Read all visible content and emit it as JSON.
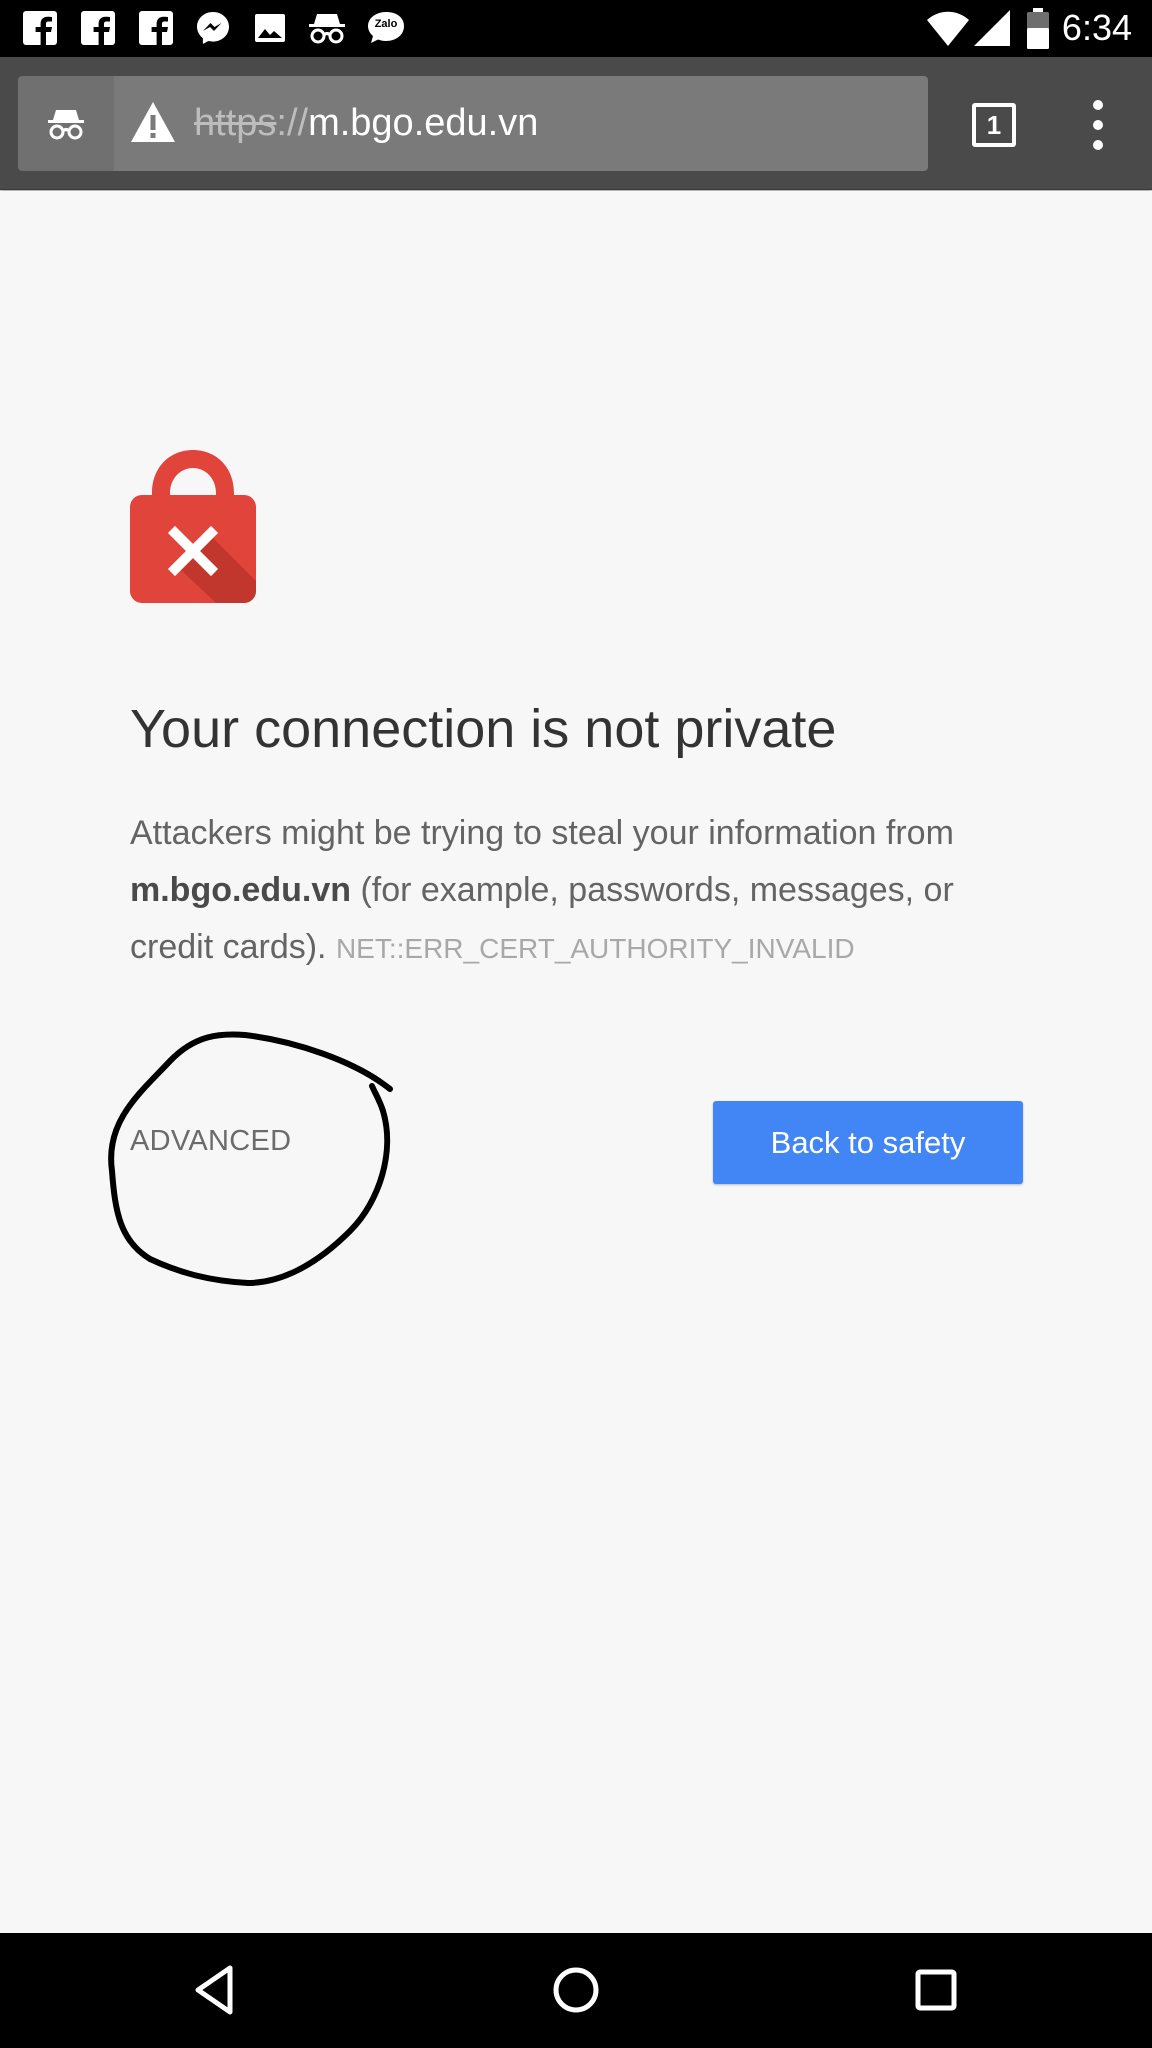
{
  "status_bar": {
    "time": "6:34",
    "notification_icons": [
      "facebook-icon",
      "facebook-icon",
      "facebook-icon",
      "messenger-icon",
      "gallery-icon",
      "incognito-icon",
      "zalo-icon"
    ],
    "zalo_label": "Zalo",
    "system_icons": [
      "wifi-icon",
      "signal-icon",
      "battery-icon"
    ]
  },
  "toolbar": {
    "url_scheme": "https",
    "url_separator": "://",
    "url_host": "m.bgo.edu.vn",
    "tab_count": "1"
  },
  "interstitial": {
    "heading": "Your connection is not private",
    "body_prefix": "Attackers might be trying to steal your information from",
    "body_domain": "m.bgo.edu.vn",
    "body_suffix": "(for example, passwords, messages, or credit cards).",
    "error_code": "NET::ERR_CERT_AUTHORITY_INVALID",
    "advanced_label": "ADVANCED",
    "back_button_label": "Back to safety"
  },
  "colors": {
    "status_bar_bg": "#000000",
    "toolbar_bg": "#4a4a4a",
    "omnibox_bg": "#7a7a7a",
    "page_bg": "#f7f7f7",
    "lock_red": "#e0443a",
    "button_blue": "#4285f4",
    "heading_text": "#333333",
    "body_text": "#646464",
    "error_code_text": "#a8a8a8"
  }
}
